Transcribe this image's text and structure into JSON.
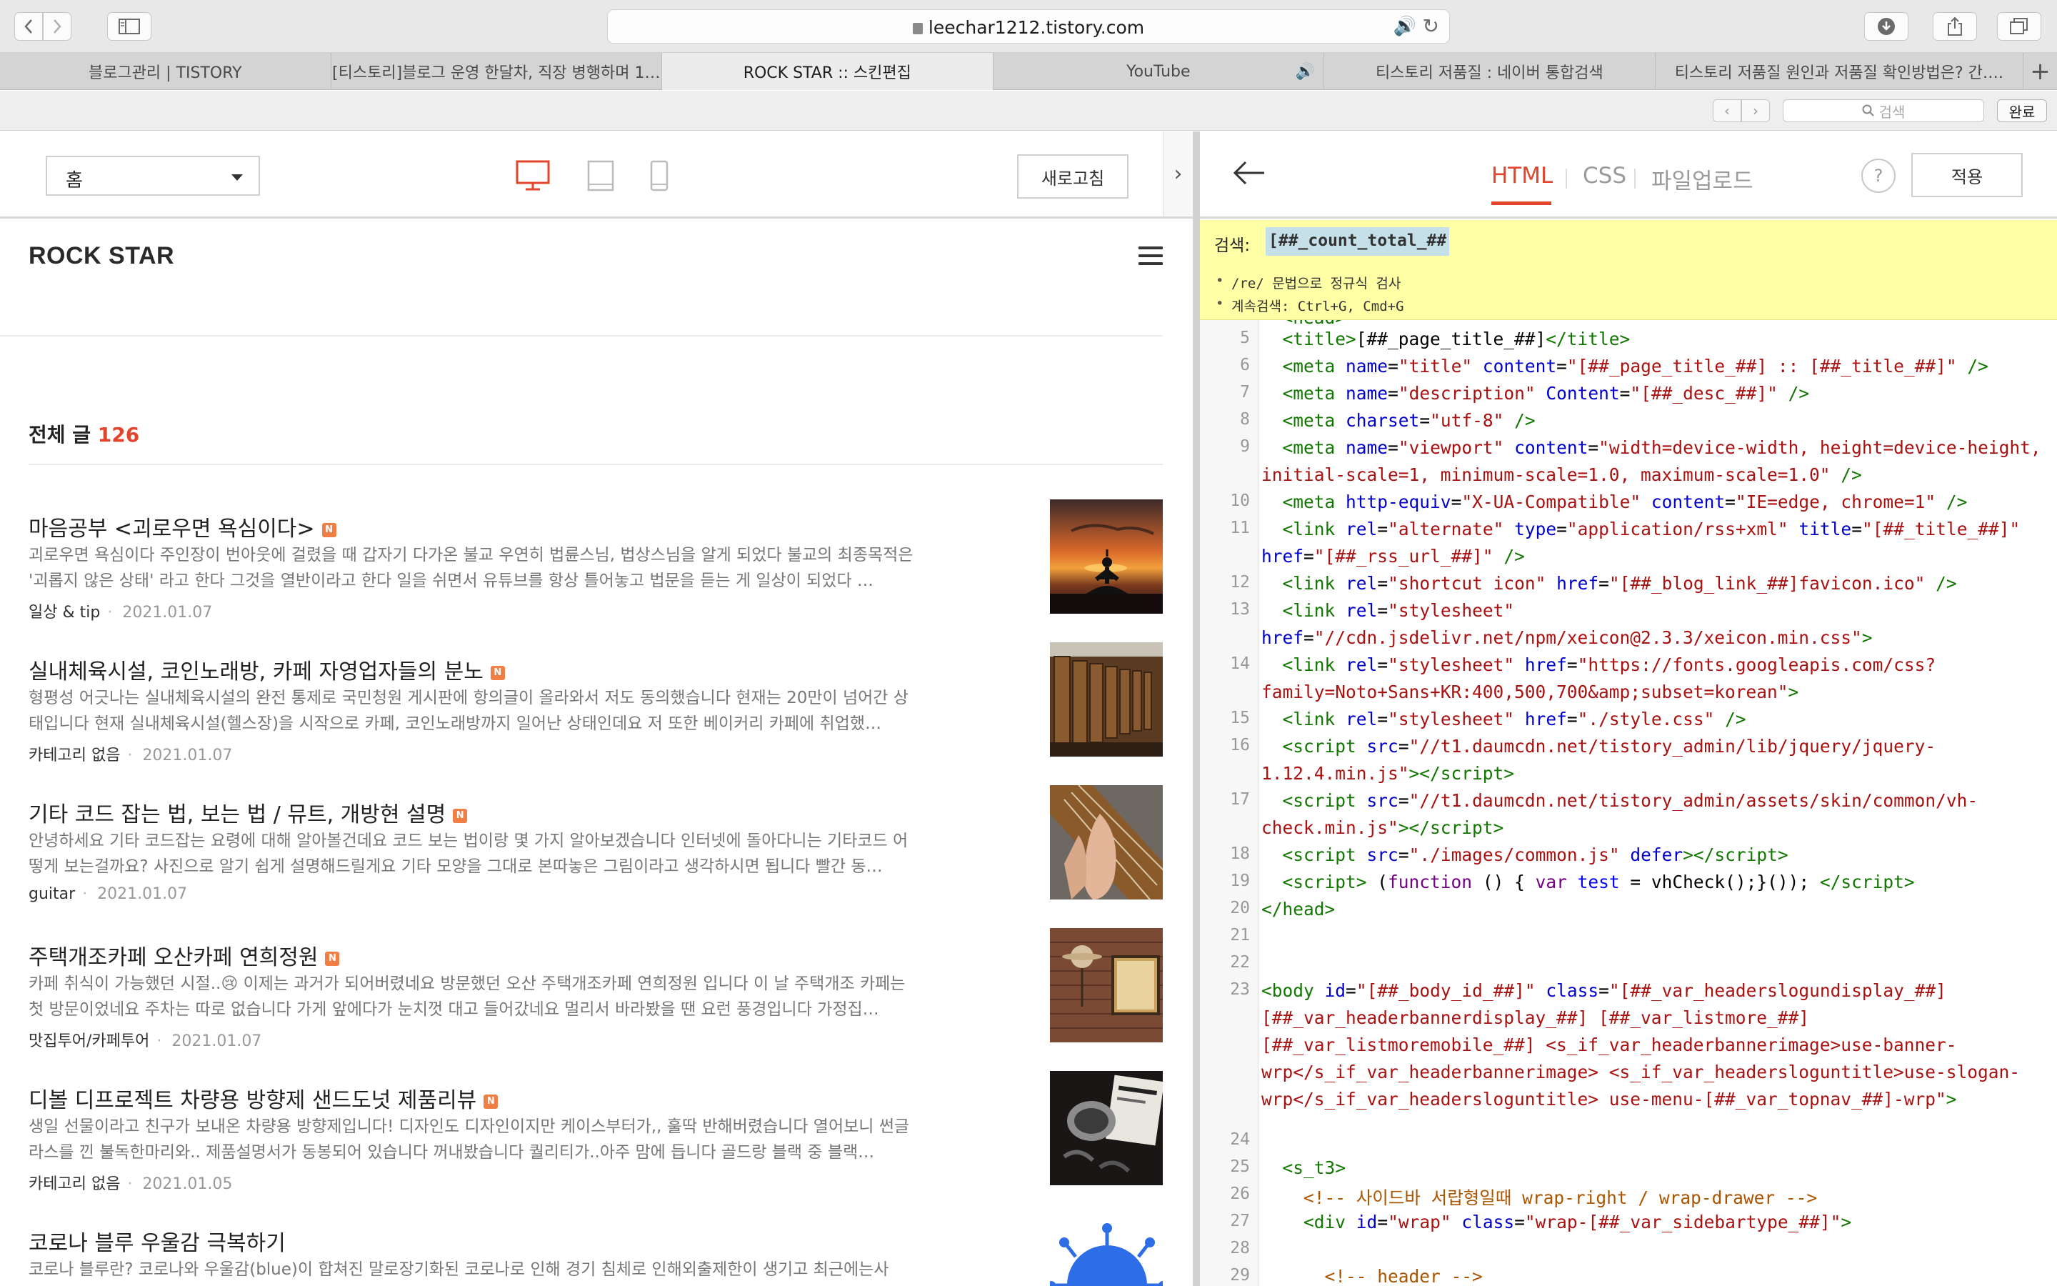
{
  "browser": {
    "url": "leechar1212.tistory.com",
    "tabs": [
      {
        "label": "블로그관리 | TISTORY"
      },
      {
        "label": "[티스토리]블로그 운영 한달차, 직장 병행하며 1…"
      },
      {
        "label": "ROCK STAR :: 스킨편집"
      },
      {
        "label": "YouTube"
      },
      {
        "label": "티스토리 저품질 : 네이버 통합검색"
      },
      {
        "label": "티스토리 저품질 원인과 저품질 확인방법은? 간…."
      }
    ],
    "find_placeholder": "검색",
    "done_label": "완료"
  },
  "preview": {
    "page_select": "홈",
    "refresh_label": "새로고침",
    "blog_title": "ROCK STAR",
    "total_label": "전체 글",
    "total_count": "126",
    "posts": [
      {
        "title": "마음공부 <괴로우면 욕심이다>",
        "excerpt": "괴로우면 욕심이다 주인장이 번아웃에 걸렸을 때 갑자기 다가온 불교 우연히 법륜스님, 법상스님을 알게 되었다 불교의 최종목적은 '괴롭지 않은 상태' 라고 한다 그것을 열반이라고 한다 일을 쉬면서 유튜브를 항상 틀어놓고 법문을 듣는 게 일상이 되었다 …",
        "category": "일상 & tip",
        "date": "2021.01.07"
      },
      {
        "title": "실내체육시설, 코인노래방, 카페 자영업자들의 분노",
        "excerpt": "형평성 어긋나는 실내체육시설의 완전 통제로 국민청원 게시판에 항의글이 올라와서 저도 동의했습니다 현재는 20만이 넘어간 상태입니다 현재 실내체육시설(헬스장)을 시작으로 카페, 코인노래방까지 일어난 상태인데요 저 또한 베이커리 카페에 취업했…",
        "category": "카테고리 없음",
        "date": "2021.01.07"
      },
      {
        "title": "기타 코드 잡는 법, 보는 법 / 뮤트, 개방현 설명",
        "excerpt": "안녕하세요 기타 코드잡는 요령에 대해 알아볼건데요 코드 보는 법이랑 몇 가지 알아보겠습니다 인터넷에 돌아다니는 기타코드 어떻게 보는걸까요? 사진으로 알기 쉽게 설명해드릴게요 기타 모양을 그대로 본따놓은 그림이라고 생각하시면 됩니다 빨간 동…",
        "category": "guitar",
        "date": "2021.01.07"
      },
      {
        "title": "주택개조카페 오산카페 연희정원",
        "excerpt": "카페 취식이 가능했던 시절..😢 이제는 과거가 되어버렸네요 방문했던 오산 주택개조카페 연희정원 입니다 이 날 주택개조 카페는 첫 방문이었네요 주차는 따로 없습니다 가게 앞에다가 눈치껏 대고 들어갔네요 멀리서 바라봤을 땐 요런 풍경입니다 가정집…",
        "category": "맛집투어/카페투어",
        "date": "2021.01.07"
      },
      {
        "title": "디볼 디프로젝트 차량용 방향제 샌드도넛 제품리뷰",
        "excerpt": "생일 선물이라고 친구가 보내온 차량용 방향제입니다! 디자인도 디자인이지만 케이스부터가,, 훌딱 반해버렸습니다 열어보니 썬글라스를 낀 불독한마리와.. 제품설명서가 동봉되어 있습니다 꺼내봤습니다 퀄리티가..아주 맘에 듭니다 골드랑 블랙 중 블랙…",
        "category": "카테고리 없음",
        "date": "2021.01.05"
      },
      {
        "title": "코로나 블루 우울감 극복하기",
        "excerpt": "코로나 블루란? 코로나와 우울감(blue)이 합쳐진 말로장기화된 코로나로 인해 경기 침체로 인해외출제한이 생기고 최근에는사",
        "category": "",
        "date": ""
      }
    ]
  },
  "editor": {
    "tabs": [
      "HTML",
      "CSS",
      "파일업로드"
    ],
    "help_label": "?",
    "apply_label": "적용",
    "search_label": "검색:",
    "search_value": "[##_count_total_##",
    "hints": [
      "/re/ 문법으로 정규식 검사",
      "계속검색: Ctrl+G, Cmd+G"
    ],
    "line_numbers": [
      "5",
      "6",
      "7",
      "8",
      "9",
      "",
      "10",
      "11",
      "",
      "12",
      "13",
      "",
      "14",
      "",
      "15",
      "16",
      "",
      "17",
      "",
      "18",
      "19",
      "20",
      "21",
      "22",
      "23",
      "",
      "",
      "",
      "",
      "24",
      "25",
      "26",
      "27",
      "28",
      "29"
    ]
  },
  "colors": {
    "accent": "#e2452b",
    "search_bg": "#ffffa6",
    "new_badge": "#f07f45"
  },
  "icons": [
    "back-arrow-icon",
    "forward-arrow-icon",
    "sidebar-toggle-icon",
    "lock-icon",
    "audio-icon",
    "reload-icon",
    "download-icon",
    "share-icon",
    "tabs-overview-icon",
    "desktop-icon",
    "tablet-icon",
    "mobile-icon",
    "hamburger-icon",
    "chevron-right-icon"
  ]
}
